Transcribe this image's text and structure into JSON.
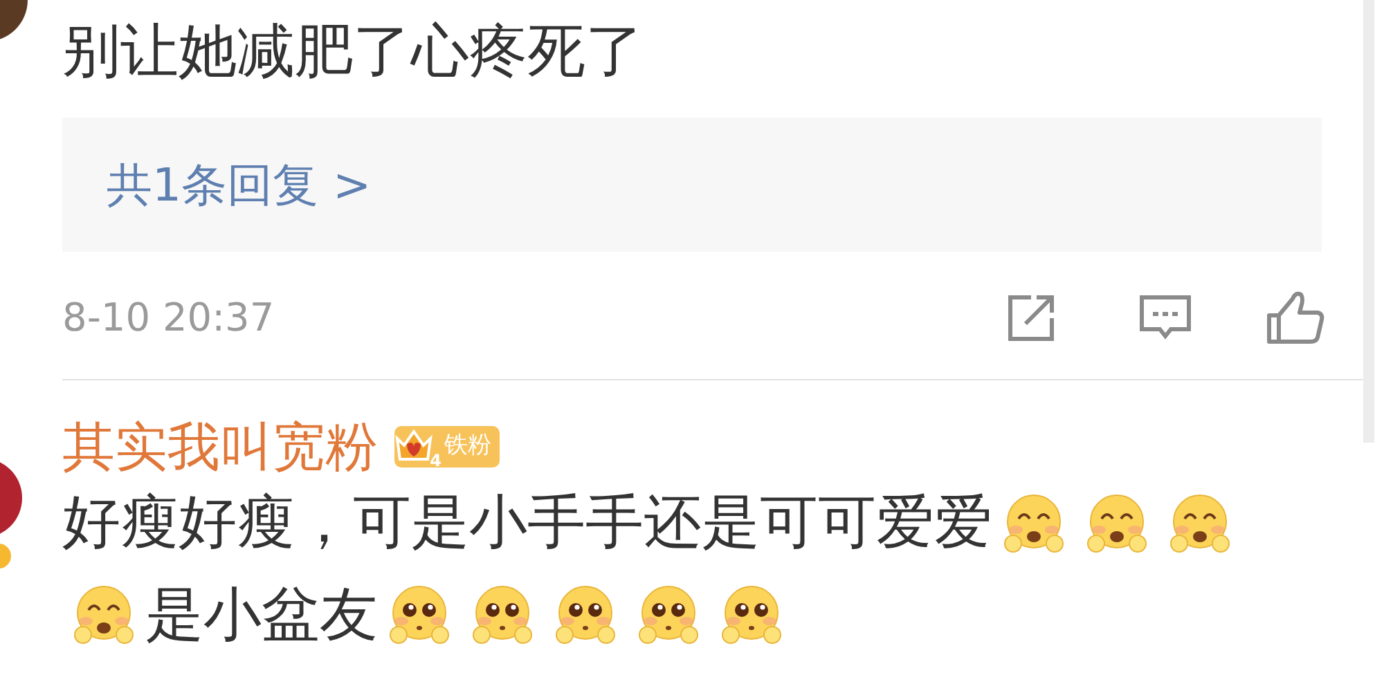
{
  "comments": [
    {
      "text": "别让她减肥了心疼死了",
      "replies": "共1条回复 >",
      "time": "8-10 20:37"
    },
    {
      "user": "其实我叫宽粉",
      "badge": {
        "level": "4",
        "label": "铁粉"
      },
      "content": [
        {
          "kind": "text",
          "text": "好瘦好瘦，可是小手手还是可可爱爱"
        },
        {
          "kind": "grin"
        },
        {
          "kind": "grin"
        },
        {
          "kind": "grin"
        },
        {
          "kind": "grin"
        },
        {
          "kind": "text",
          "text": "是小盆友"
        },
        {
          "kind": "plead"
        },
        {
          "kind": "plead"
        },
        {
          "kind": "plead"
        },
        {
          "kind": "plead"
        },
        {
          "kind": "plead"
        }
      ]
    }
  ]
}
